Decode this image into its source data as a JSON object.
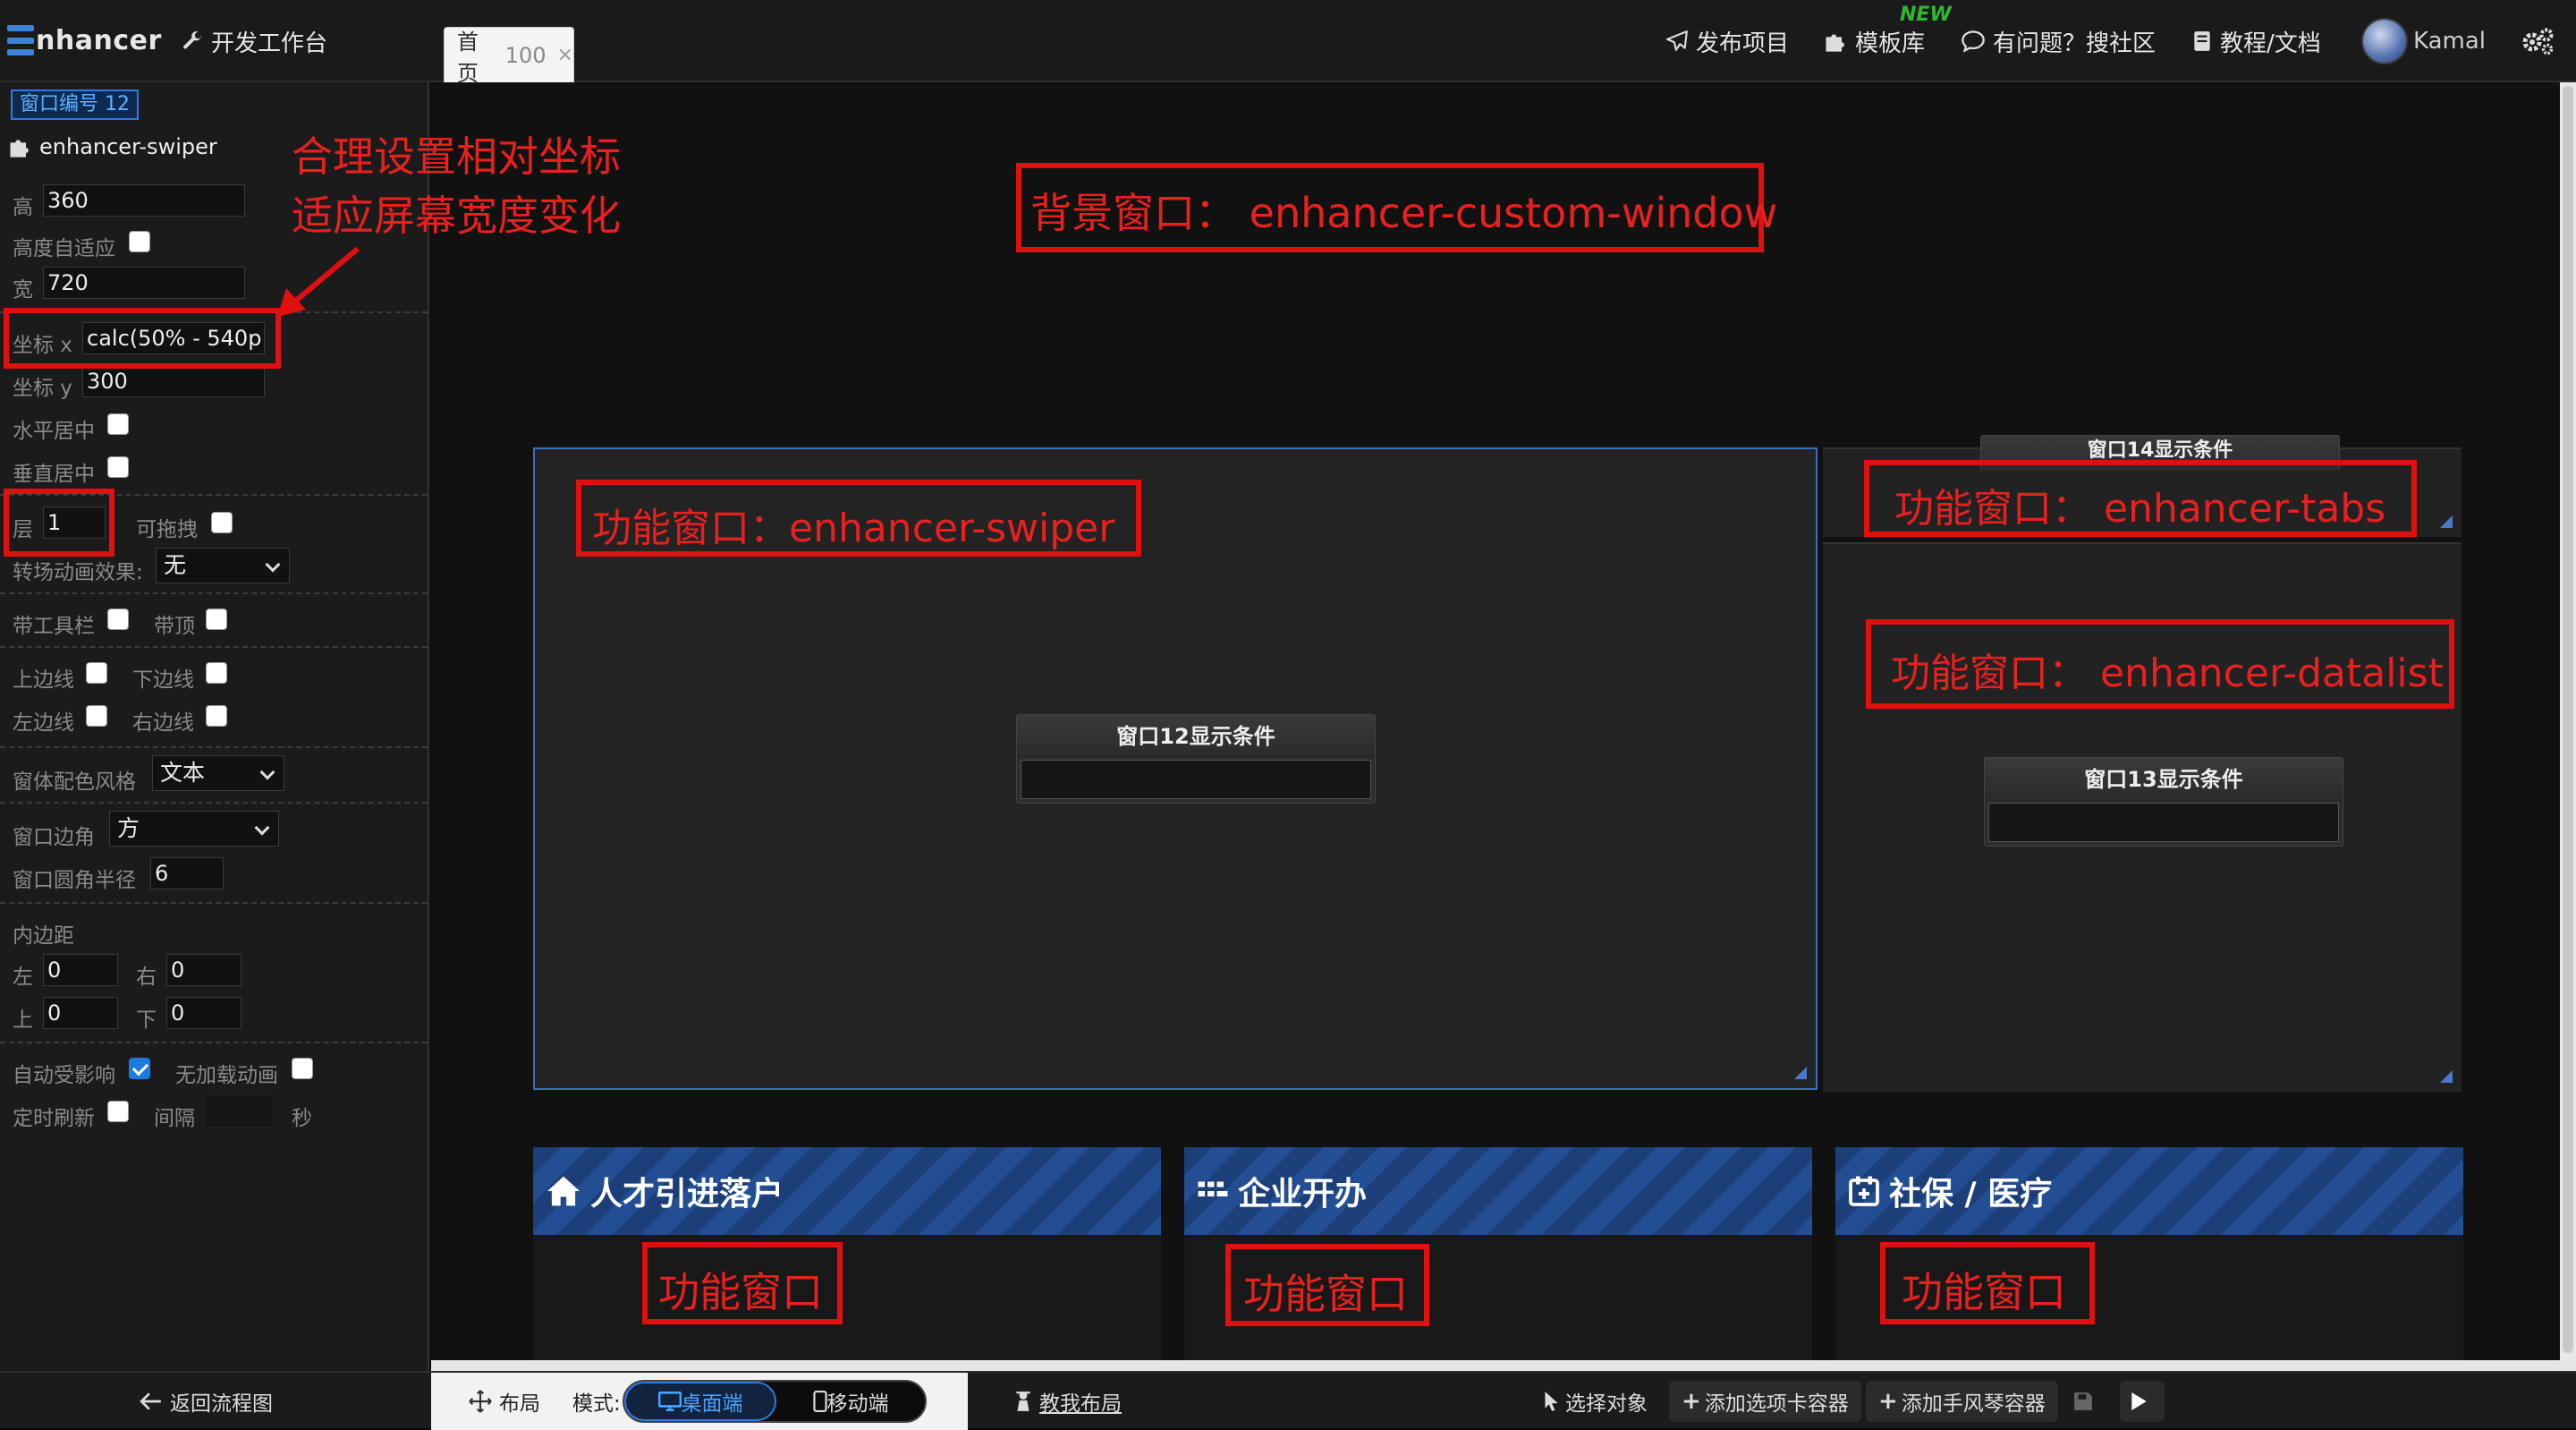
{
  "app": {
    "logo_rest": "nhancer",
    "workbench": "开发工作台"
  },
  "tab": {
    "label": "首页",
    "num": "100",
    "close": "×"
  },
  "topnav": {
    "publish": "发布项目",
    "templates": "模板库",
    "new_badge": "NEW",
    "community": "有问题？搜社区",
    "docs": "教程/文档",
    "user": "Kamal"
  },
  "sidebar": {
    "window_no": "窗口编号 12",
    "component": "enhancer-swiper",
    "height_label": "高",
    "height_value": "360",
    "auto_height_label": "高度自适应",
    "width_label": "宽",
    "width_value": "720",
    "x_label": "坐标 x",
    "x_value": "calc(50% - 540p",
    "y_label": "坐标 y",
    "y_value": "300",
    "hcenter_label": "水平居中",
    "vcenter_label": "垂直居中",
    "layer_label": "层",
    "layer_value": "1",
    "draggable_label": "可拖拽",
    "transition_label": "转场动画效果:",
    "transition_value": "无",
    "toolbar_label": "带工具栏",
    "top_label": "带顶",
    "top_border_label": "上边线",
    "bottom_border_label": "下边线",
    "left_border_label": "左边线",
    "right_border_label": "右边线",
    "color_style_label": "窗体配色风格",
    "color_style_value": "文本",
    "corner_label": "窗口边角",
    "corner_value": "方",
    "radius_label": "窗口圆角半径",
    "radius_value": "6",
    "padding_label": "内边距",
    "pad_left_label": "左",
    "pad_left_value": "0",
    "pad_right_label": "右",
    "pad_right_value": "0",
    "pad_top_label": "上",
    "pad_top_value": "0",
    "pad_bottom_label": "下",
    "pad_bottom_value": "0",
    "auto_affect_label": "自动受影响",
    "no_load_anim_label": "无加载动画",
    "timer_label": "定时刷新",
    "interval_label": "间隔",
    "interval_value": "",
    "seconds_label": "秒"
  },
  "annotations": {
    "tip_line1": "合理设置相对坐标",
    "tip_line2": "适应屏幕宽度变化",
    "bg_window": "背景窗口：  enhancer-custom-window",
    "swiper": "功能窗口：enhancer-swiper",
    "tabs": "功能窗口：  enhancer-tabs",
    "datalist": "功能窗口：  enhancer-datalist",
    "card_fn": "功能窗口"
  },
  "stage": {
    "cond12": "窗口12显示条件",
    "cond14": "窗口14显示条件",
    "cond13": "窗口13显示条件"
  },
  "cards": [
    {
      "title": "人才引进落户",
      "icon": "home-icon"
    },
    {
      "title": "企业开办",
      "icon": "grid-icon"
    },
    {
      "title": "社保 / 医疗",
      "icon": "calendar-icon"
    }
  ],
  "bottombar": {
    "back": "返回流程图",
    "layout": "布局",
    "mode_label": "模式:",
    "desktop": "桌面端",
    "mobile": "移动端",
    "teach": "教我布局",
    "select": "选择对象",
    "add_tabs": "添加选项卡容器",
    "add_accordion": "添加手风琴容器"
  },
  "colors": {
    "accent": "#1f7ae0",
    "annotation": "#e01010",
    "card_header": "#1c3f7a"
  }
}
